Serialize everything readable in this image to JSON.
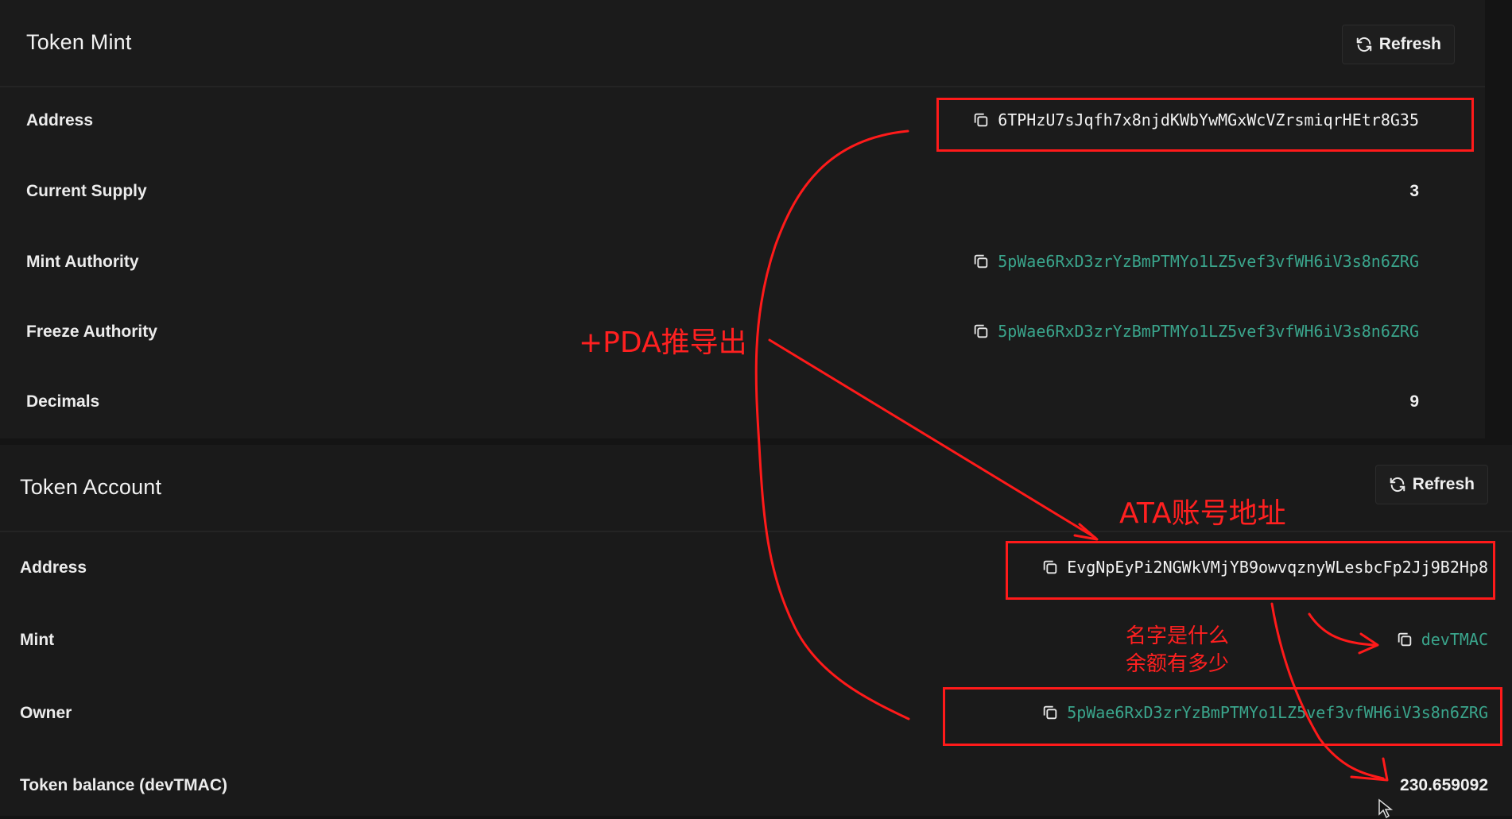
{
  "token_mint": {
    "title": "Token Mint",
    "refresh_label": "Refresh",
    "rows": [
      {
        "label": "Address",
        "value": "6TPHzU7sJqfh7x8njdKWbYwMGxWcVZrsmiqrHEtr8G35"
      },
      {
        "label": "Current Supply",
        "value": "3"
      },
      {
        "label": "Mint Authority",
        "value": "5pWae6RxD3zrYzBmPTMYo1LZ5vef3vfWH6iV3s8n6ZRG"
      },
      {
        "label": "Freeze Authority",
        "value": "5pWae6RxD3zrYzBmPTMYo1LZ5vef3vfWH6iV3s8n6ZRG"
      },
      {
        "label": "Decimals",
        "value": "9"
      }
    ]
  },
  "token_account": {
    "title": "Token Account",
    "refresh_label": "Refresh",
    "rows": [
      {
        "label": "Address",
        "value": "EvgNpEyPi2NGWkVMjYB9owvqznyWLesbcFp2Jj9B2Hp8"
      },
      {
        "label": "Mint",
        "value": "devTMAC"
      },
      {
        "label": "Owner",
        "value": "5pWae6RxD3zrYzBmPTMYo1LZ5vef3vfWH6iV3s8n6ZRG"
      },
      {
        "label": "Token balance (devTMAC)",
        "value": "230.659092"
      }
    ]
  },
  "annotations": {
    "pda_derive": "+PDA推导出",
    "ata_address": "ATA账号地址",
    "name_line": "名字是什么",
    "balance_line": "余额有多少"
  },
  "colors": {
    "background": "#141414",
    "panel": "#1b1b1b",
    "link": "#3aa58c",
    "annotation_red": "#ff1a1a"
  },
  "icons": {
    "refresh": "refresh-icon",
    "copy": "copy-icon",
    "cursor": "mouse-cursor-icon"
  }
}
